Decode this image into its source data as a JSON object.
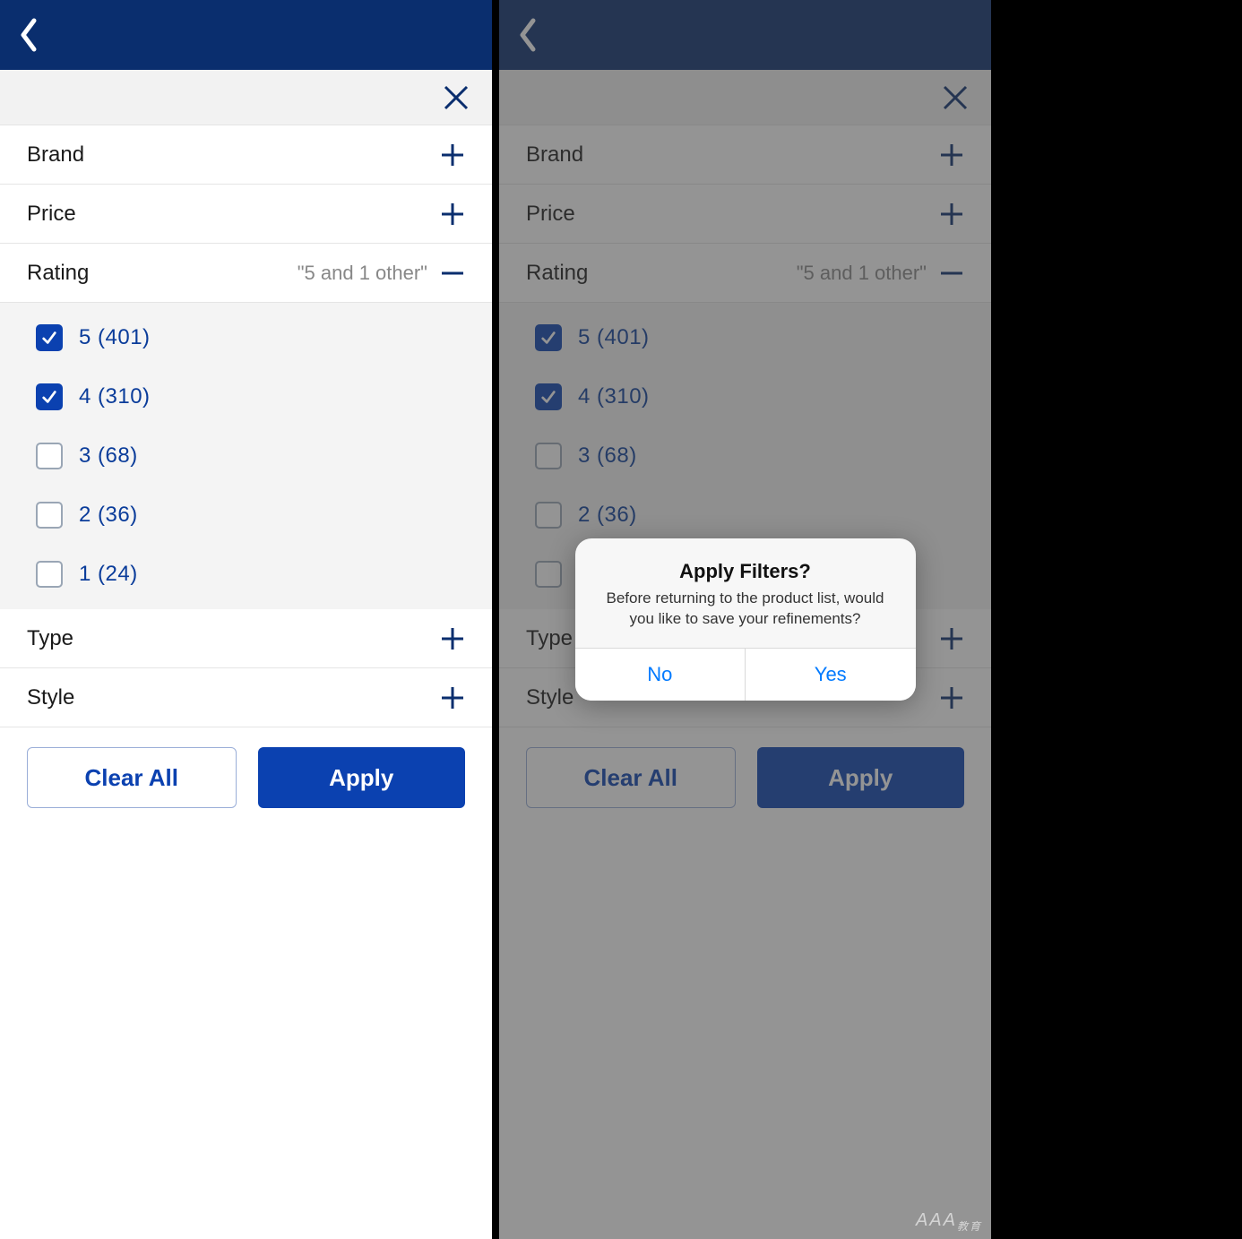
{
  "colors": {
    "navy": "#0a2e6e",
    "accent": "#0b41b0",
    "iosBlue": "#007aff"
  },
  "filters": [
    {
      "label": "Brand",
      "expanded": false
    },
    {
      "label": "Price",
      "expanded": false
    },
    {
      "label": "Rating",
      "expanded": true,
      "summary": "\"5 and 1 other\"",
      "options": [
        {
          "label": "5  (401)",
          "checked": true
        },
        {
          "label": "4  (310)",
          "checked": true
        },
        {
          "label": "3  (68)",
          "checked": false
        },
        {
          "label": "2  (36)",
          "checked": false
        },
        {
          "label": "1  (24)",
          "checked": false
        }
      ]
    },
    {
      "label": "Type",
      "expanded": false
    },
    {
      "label": "Style",
      "expanded": false
    }
  ],
  "buttons": {
    "clear": "Clear All",
    "apply": "Apply"
  },
  "alert": {
    "title": "Apply Filters?",
    "message": "Before returning to the product list, would you like to save your refinements?",
    "no": "No",
    "yes": "Yes"
  },
  "watermark": "AAA",
  "watermark_suffix": "教育"
}
